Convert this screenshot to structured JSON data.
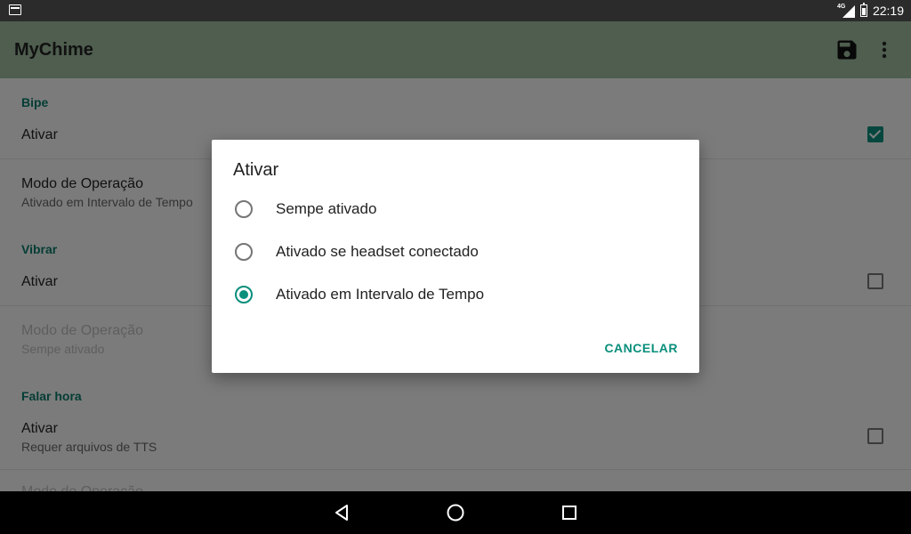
{
  "status_bar": {
    "network": "4G",
    "time": "22:19"
  },
  "app": {
    "title": "MyChime",
    "save_icon": "save-icon",
    "more_icon": "more-vert-icon"
  },
  "sections": {
    "bipe": {
      "header": "Bipe",
      "ativar": "Ativar",
      "ativar_checked": true,
      "modo_title": "Modo de Operação",
      "modo_sub": "Ativado em Intervalo de Tempo"
    },
    "vibrar": {
      "header": "Vibrar",
      "ativar": "Ativar",
      "ativar_checked": false,
      "modo_title": "Modo de Operação",
      "modo_sub": "Sempe ativado"
    },
    "falar": {
      "header": "Falar hora",
      "ativar": "Ativar",
      "ativar_sub": "Requer arquivos de TTS",
      "ativar_checked": false,
      "next_title": "Modo de Operação"
    }
  },
  "dialog": {
    "title": "Ativar",
    "options": [
      {
        "label": "Sempe ativado",
        "selected": false
      },
      {
        "label": "Ativado se headset conectado",
        "selected": false
      },
      {
        "label": "Ativado em Intervalo de Tempo",
        "selected": true
      }
    ],
    "cancel": "CANCELAR"
  },
  "colors": {
    "accent": "#0a8f7c",
    "appbar": "#9ebd9e",
    "section_label": "#0b7a6a"
  },
  "nav": {
    "back": "back-icon",
    "home": "home-icon",
    "recents": "recents-icon"
  }
}
